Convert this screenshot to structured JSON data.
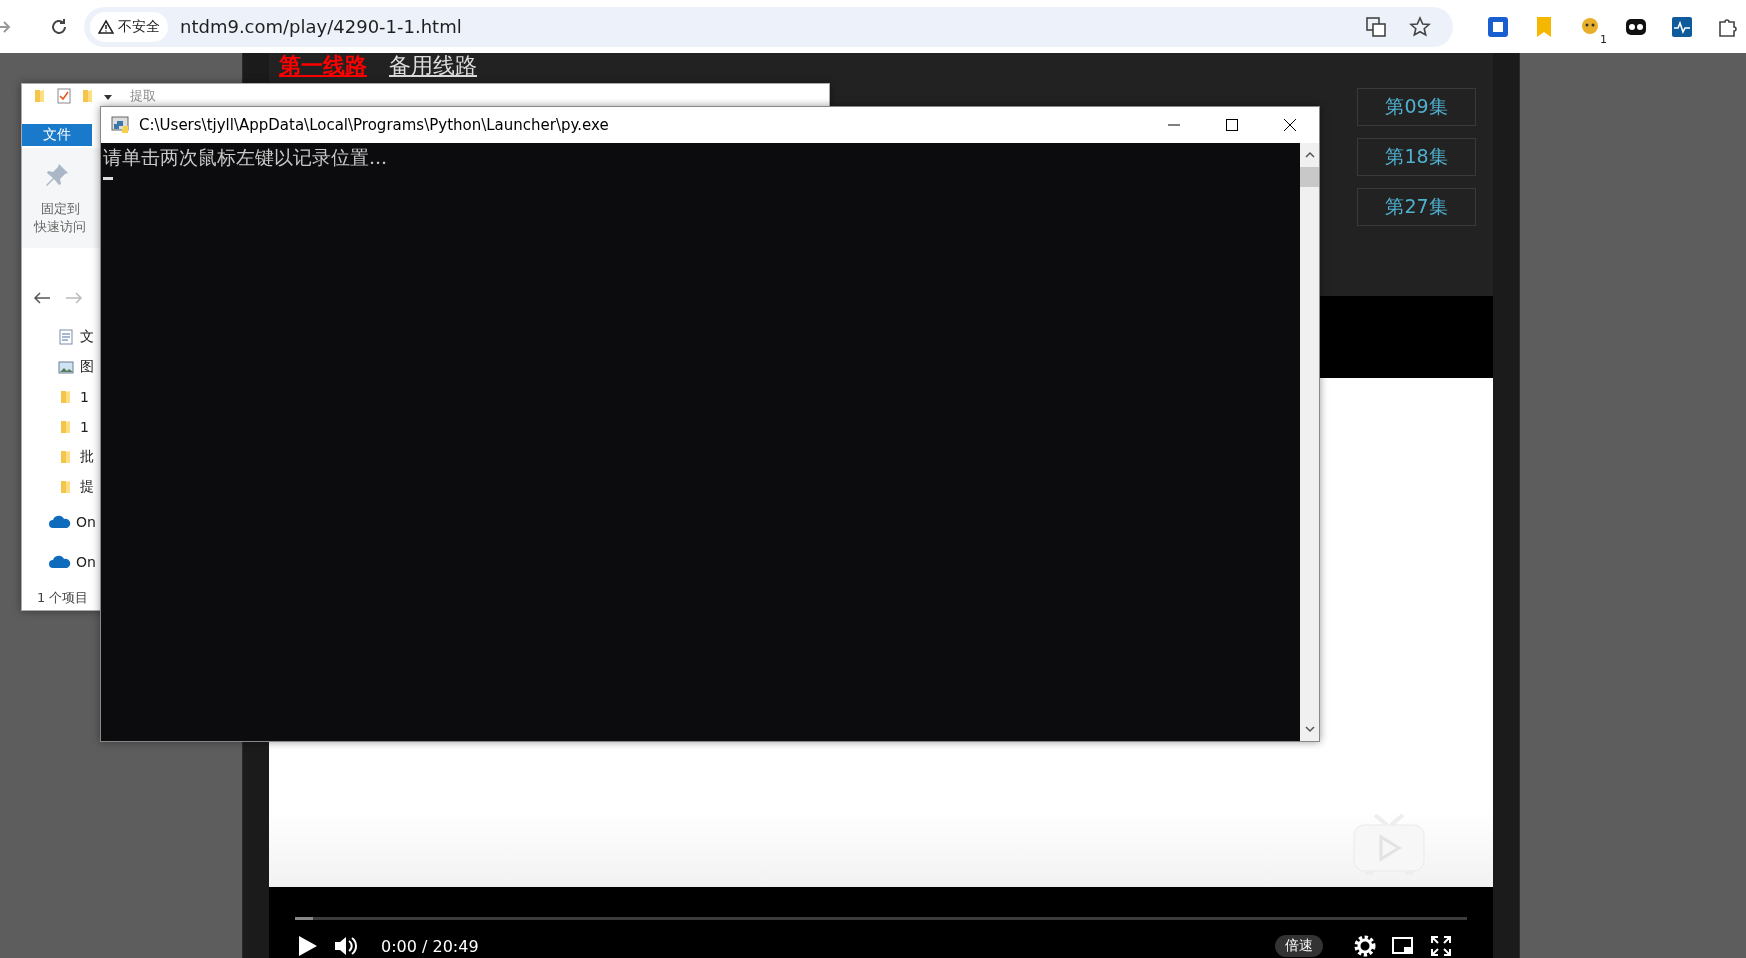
{
  "browser": {
    "security_label": "不安全",
    "url": "ntdm9.com/play/4290-1-1.html",
    "extension_badge": "1"
  },
  "web_page": {
    "lines": [
      {
        "label": "第一线路",
        "selected": true
      },
      {
        "label": "备用线路",
        "selected": false
      }
    ],
    "episodes": [
      {
        "label": "第09集"
      },
      {
        "label": "第18集"
      },
      {
        "label": "第27集"
      }
    ],
    "player": {
      "level": 0.015,
      "time": "0:00 / 20:49",
      "speed": "倍速"
    }
  },
  "explorer": {
    "toolbar_label": "提取",
    "file_tab": "文件",
    "pin_label": [
      "固定到",
      "快速访问"
    ],
    "items": [
      {
        "kind": "document",
        "label": "文"
      },
      {
        "kind": "image",
        "label": "图"
      },
      {
        "kind": "folder",
        "label": "1"
      },
      {
        "kind": "folder",
        "label": "1"
      },
      {
        "kind": "folder",
        "label": "批"
      },
      {
        "kind": "folder",
        "label": "提"
      },
      {
        "kind": "cloud",
        "label": "On"
      },
      {
        "kind": "cloud",
        "label": "On"
      }
    ],
    "status": "1 个项目"
  },
  "console": {
    "title": "C:\\Users\\tjyll\\AppData\\Local\\Programs\\Python\\Launcher\\py.exe",
    "output": "请单击两次鼠标左键以记录位置..."
  }
}
